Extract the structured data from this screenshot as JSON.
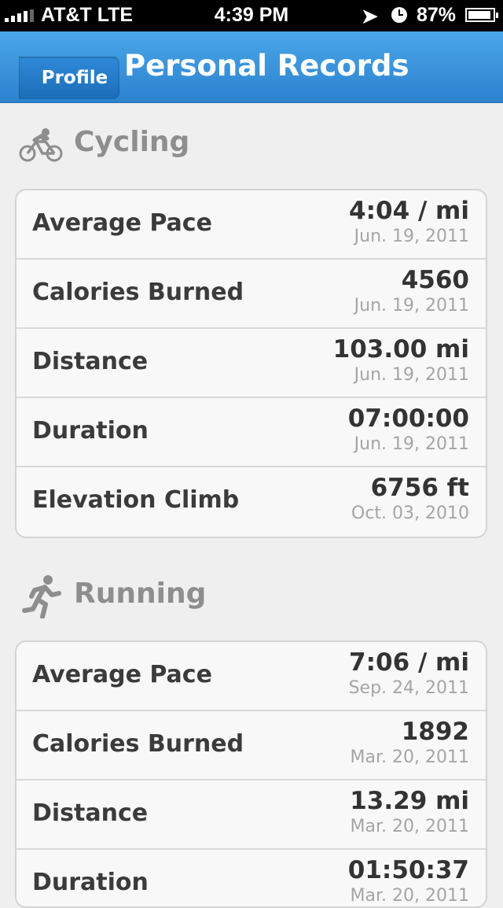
{
  "status_bar": {
    "carrier": "AT&T  LTE",
    "time": "4:39 PM",
    "battery": "87%"
  },
  "nav": {
    "back_label": "Profile",
    "title": "Personal Records"
  },
  "sections": [
    {
      "title": "Cycling",
      "icon": "bicycle-icon",
      "records": [
        {
          "label": "Average Pace",
          "value": "4:04 / mi",
          "date": "Jun. 19, 2011"
        },
        {
          "label": "Calories Burned",
          "value": "4560",
          "date": "Jun. 19, 2011"
        },
        {
          "label": "Distance",
          "value": "103.00 mi",
          "date": "Jun. 19, 2011"
        },
        {
          "label": "Duration",
          "value": "07:00:00",
          "date": "Jun. 19, 2011"
        },
        {
          "label": "Elevation Climb",
          "value": "6756 ft",
          "date": "Oct. 03, 2010"
        }
      ]
    },
    {
      "title": "Running",
      "icon": "runner-icon",
      "records": [
        {
          "label": "Average Pace",
          "value": "7:06 / mi",
          "date": "Sep. 24, 2011"
        },
        {
          "label": "Calories Burned",
          "value": "1892",
          "date": "Mar. 20, 2011"
        },
        {
          "label": "Distance",
          "value": "13.29 mi",
          "date": "Mar. 20, 2011"
        },
        {
          "label": "Duration",
          "value": "01:50:37",
          "date": "Mar. 20, 2011"
        }
      ]
    }
  ]
}
